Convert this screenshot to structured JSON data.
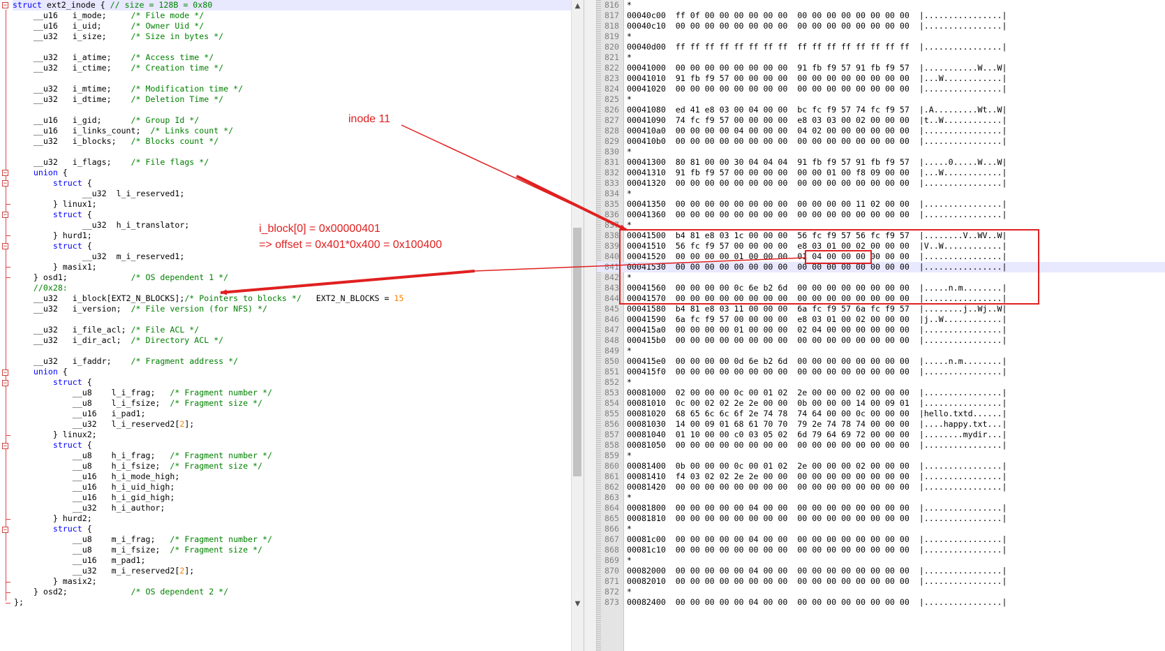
{
  "code_editor": {
    "lines": [
      [
        [
          "kw",
          "struct"
        ],
        [
          "tw",
          " ext2_inode { "
        ],
        [
          "cm",
          "// size = 128B = 0x80"
        ]
      ],
      [
        [
          "tw",
          "    __u16   i_mode;     "
        ],
        [
          "cm",
          "/* File mode */"
        ]
      ],
      [
        [
          "tw",
          "    __u16   i_uid;      "
        ],
        [
          "cm",
          "/* Owner Uid */"
        ]
      ],
      [
        [
          "tw",
          "    __u32   i_size;     "
        ],
        [
          "cm",
          "/* Size in bytes */"
        ]
      ],
      [],
      [
        [
          "tw",
          "    __u32   i_atime;    "
        ],
        [
          "cm",
          "/* Access time */"
        ]
      ],
      [
        [
          "tw",
          "    __u32   i_ctime;    "
        ],
        [
          "cm",
          "/* Creation time */"
        ]
      ],
      [],
      [
        [
          "tw",
          "    __u32   i_mtime;    "
        ],
        [
          "cm",
          "/* Modification time */"
        ]
      ],
      [
        [
          "tw",
          "    __u32   i_dtime;    "
        ],
        [
          "cm",
          "/* Deletion Time */"
        ]
      ],
      [],
      [
        [
          "tw",
          "    __u16   i_gid;      "
        ],
        [
          "cm",
          "/* Group Id */"
        ]
      ],
      [
        [
          "tw",
          "    __u16   i_links_count;  "
        ],
        [
          "cm",
          "/* Links count */"
        ]
      ],
      [
        [
          "tw",
          "    __u32   i_blocks;   "
        ],
        [
          "cm",
          "/* Blocks count */"
        ]
      ],
      [],
      [
        [
          "tw",
          "    __u32   i_flags;    "
        ],
        [
          "cm",
          "/* File flags */"
        ]
      ],
      [
        [
          "kw",
          "    union"
        ],
        [
          "tw",
          " {"
        ]
      ],
      [
        [
          "kw",
          "        struct"
        ],
        [
          "tw",
          " {"
        ]
      ],
      [
        [
          "tw",
          "              __u32  l_i_reserved1;"
        ]
      ],
      [
        [
          "tw",
          "        } linux1;"
        ]
      ],
      [
        [
          "kw",
          "        struct"
        ],
        [
          "tw",
          " {"
        ]
      ],
      [
        [
          "tw",
          "              __u32  h_i_translator;"
        ]
      ],
      [
        [
          "tw",
          "        } hurd1;"
        ]
      ],
      [
        [
          "kw",
          "        struct"
        ],
        [
          "tw",
          " {"
        ]
      ],
      [
        [
          "tw",
          "              __u32  m_i_reserved1;"
        ]
      ],
      [
        [
          "tw",
          "        } masix1;"
        ]
      ],
      [
        [
          "tw",
          "    } osd1;             "
        ],
        [
          "cm",
          "/* OS dependent 1 */"
        ]
      ],
      [
        [
          "cm",
          "    //0x28:"
        ]
      ],
      [
        [
          "tw",
          "    __u32   i_block[EXT2_N_BLOCKS];"
        ],
        [
          "cm",
          "/* Pointers to blocks */"
        ],
        [
          "tw",
          "   EXT2_N_BLOCKS = "
        ],
        [
          "num",
          "15"
        ]
      ],
      [
        [
          "tw",
          "    __u32   i_version;  "
        ],
        [
          "cm",
          "/* File version (for NFS) */"
        ]
      ],
      [],
      [
        [
          "tw",
          "    __u32   i_file_acl; "
        ],
        [
          "cm",
          "/* File ACL */"
        ]
      ],
      [
        [
          "tw",
          "    __u32   i_dir_acl;  "
        ],
        [
          "cm",
          "/* Directory ACL */"
        ]
      ],
      [],
      [
        [
          "tw",
          "    __u32   i_faddr;    "
        ],
        [
          "cm",
          "/* Fragment address */"
        ]
      ],
      [
        [
          "kw",
          "    union"
        ],
        [
          "tw",
          " {"
        ]
      ],
      [
        [
          "kw",
          "        struct"
        ],
        [
          "tw",
          " {"
        ]
      ],
      [
        [
          "tw",
          "            __u8    l_i_frag;   "
        ],
        [
          "cm",
          "/* Fragment number */"
        ]
      ],
      [
        [
          "tw",
          "            __u8    l_i_fsize;  "
        ],
        [
          "cm",
          "/* Fragment size */"
        ]
      ],
      [
        [
          "tw",
          "            __u16   i_pad1;"
        ]
      ],
      [
        [
          "tw",
          "            __u32   l_i_reserved2["
        ],
        [
          "num",
          "2"
        ],
        [
          "tw",
          "];"
        ]
      ],
      [
        [
          "tw",
          "        } linux2;"
        ]
      ],
      [
        [
          "kw",
          "        struct"
        ],
        [
          "tw",
          " {"
        ]
      ],
      [
        [
          "tw",
          "            __u8    h_i_frag;   "
        ],
        [
          "cm",
          "/* Fragment number */"
        ]
      ],
      [
        [
          "tw",
          "            __u8    h_i_fsize;  "
        ],
        [
          "cm",
          "/* Fragment size */"
        ]
      ],
      [
        [
          "tw",
          "            __u16   h_i_mode_high;"
        ]
      ],
      [
        [
          "tw",
          "            __u16   h_i_uid_high;"
        ]
      ],
      [
        [
          "tw",
          "            __u16   h_i_gid_high;"
        ]
      ],
      [
        [
          "tw",
          "            __u32   h_i_author;"
        ]
      ],
      [
        [
          "tw",
          "        } hurd2;"
        ]
      ],
      [
        [
          "kw",
          "        struct"
        ],
        [
          "tw",
          " {"
        ]
      ],
      [
        [
          "tw",
          "            __u8    m_i_frag;   "
        ],
        [
          "cm",
          "/* Fragment number */"
        ]
      ],
      [
        [
          "tw",
          "            __u8    m_i_fsize;  "
        ],
        [
          "cm",
          "/* Fragment size */"
        ]
      ],
      [
        [
          "tw",
          "            __u16   m_pad1;"
        ]
      ],
      [
        [
          "tw",
          "            __u32   m_i_reserved2["
        ],
        [
          "num",
          "2"
        ],
        [
          "tw",
          "];"
        ]
      ],
      [
        [
          "tw",
          "        } masix2;"
        ]
      ],
      [
        [
          "tw",
          "    } osd2;             "
        ],
        [
          "cm",
          "/* OS dependent 2 */"
        ]
      ],
      [
        [
          "tw",
          "};"
        ]
      ]
    ]
  },
  "hex_view": {
    "lines": [
      {
        "n": "816",
        "t": "*"
      },
      {
        "n": "817",
        "t": "00040c00  ff 0f 00 00 00 00 00 00  00 00 00 00 00 00 00 00  |................|"
      },
      {
        "n": "818",
        "t": "00040c10  00 00 00 00 00 00 00 00  00 00 00 00 00 00 00 00  |................|"
      },
      {
        "n": "819",
        "t": "*"
      },
      {
        "n": "820",
        "t": "00040d00  ff ff ff ff ff ff ff ff  ff ff ff ff ff ff ff ff  |................|"
      },
      {
        "n": "821",
        "t": "*"
      },
      {
        "n": "822",
        "t": "00041000  00 00 00 00 00 00 00 00  91 fb f9 57 91 fb f9 57  |...........W...W|"
      },
      {
        "n": "823",
        "t": "00041010  91 fb f9 57 00 00 00 00  00 00 00 00 00 00 00 00  |...W............|"
      },
      {
        "n": "824",
        "t": "00041020  00 00 00 00 00 00 00 00  00 00 00 00 00 00 00 00  |................|"
      },
      {
        "n": "825",
        "t": "*"
      },
      {
        "n": "826",
        "t": "00041080  ed 41 e8 03 00 04 00 00  bc fc f9 57 74 fc f9 57  |.A.........Wt..W|"
      },
      {
        "n": "827",
        "t": "00041090  74 fc f9 57 00 00 00 00  e8 03 03 00 02 00 00 00  |t..W............|"
      },
      {
        "n": "828",
        "t": "000410a0  00 00 00 00 04 00 00 00  04 02 00 00 00 00 00 00  |................|"
      },
      {
        "n": "829",
        "t": "000410b0  00 00 00 00 00 00 00 00  00 00 00 00 00 00 00 00  |................|"
      },
      {
        "n": "830",
        "t": "*"
      },
      {
        "n": "831",
        "t": "00041300  80 81 00 00 30 04 04 04  91 fb f9 57 91 fb f9 57  |.....0.....W...W|"
      },
      {
        "n": "832",
        "t": "00041310  91 fb f9 57 00 00 00 00  00 00 01 00 f8 09 00 00  |...W............|"
      },
      {
        "n": "833",
        "t": "00041320  00 00 00 00 00 00 00 00  00 00 00 00 00 00 00 00  |................|"
      },
      {
        "n": "834",
        "t": "*"
      },
      {
        "n": "835",
        "t": "00041350  00 00 00 00 00 00 00 00  00 00 00 00 11 02 00 00  |................|"
      },
      {
        "n": "836",
        "t": "00041360  00 00 00 00 00 00 00 00  00 00 00 00 00 00 00 00  |................|"
      },
      {
        "n": "837",
        "t": "*"
      },
      {
        "n": "838",
        "t": "00041500  b4 81 e8 03 1c 00 00 00  56 fc f9 57 56 fc f9 57  |........V..WV..W|"
      },
      {
        "n": "839",
        "t": "00041510  56 fc f9 57 00 00 00 00  e8 03 01 00 02 00 00 00  |V..W............|"
      },
      {
        "n": "840",
        "t": "00041520  00 00 00 00 01 00 00 00  01 04 00 00 00 00 00 00  |................|"
      },
      {
        "n": "841",
        "t": "00041530  00 00 00 00 00 00 00 00  00 00 00 00 00 00 00 00  |................|"
      },
      {
        "n": "842",
        "t": "*"
      },
      {
        "n": "843",
        "t": "00041560  00 00 00 00 0c 6e b2 6d  00 00 00 00 00 00 00 00  |.....n.m........|"
      },
      {
        "n": "844",
        "t": "00041570  00 00 00 00 00 00 00 00  00 00 00 00 00 00 00 00  |................|"
      },
      {
        "n": "845",
        "t": "00041580  b4 81 e8 03 11 00 00 00  6a fc f9 57 6a fc f9 57  |........j..Wj..W|"
      },
      {
        "n": "846",
        "t": "00041590  6a fc f9 57 00 00 00 00  e8 03 01 00 02 00 00 00  |j..W............|"
      },
      {
        "n": "847",
        "t": "000415a0  00 00 00 00 01 00 00 00  02 04 00 00 00 00 00 00  |................|"
      },
      {
        "n": "848",
        "t": "000415b0  00 00 00 00 00 00 00 00  00 00 00 00 00 00 00 00  |................|"
      },
      {
        "n": "849",
        "t": "*"
      },
      {
        "n": "850",
        "t": "000415e0  00 00 00 00 0d 6e b2 6d  00 00 00 00 00 00 00 00  |.....n.m........|"
      },
      {
        "n": "851",
        "t": "000415f0  00 00 00 00 00 00 00 00  00 00 00 00 00 00 00 00  |................|"
      },
      {
        "n": "852",
        "t": "*"
      },
      {
        "n": "853",
        "t": "00081000  02 00 00 00 0c 00 01 02  2e 00 00 00 02 00 00 00  |................|"
      },
      {
        "n": "854",
        "t": "00081010  0c 00 02 02 2e 2e 00 00  0b 00 00 00 14 00 09 01  |................|"
      },
      {
        "n": "855",
        "t": "00081020  68 65 6c 6c 6f 2e 74 78  74 64 00 00 0c 00 00 00  |hello.txtd......|"
      },
      {
        "n": "856",
        "t": "00081030  14 00 09 01 68 61 70 70  79 2e 74 78 74 00 00 00  |....happy.txt...|"
      },
      {
        "n": "857",
        "t": "00081040  01 10 00 00 c0 03 05 02  6d 79 64 69 72 00 00 00  |........mydir...|"
      },
      {
        "n": "858",
        "t": "00081050  00 00 00 00 00 00 00 00  00 00 00 00 00 00 00 00  |................|"
      },
      {
        "n": "859",
        "t": "*"
      },
      {
        "n": "860",
        "t": "00081400  0b 00 00 00 0c 00 01 02  2e 00 00 00 02 00 00 00  |................|"
      },
      {
        "n": "861",
        "t": "00081410  f4 03 02 02 2e 2e 00 00  00 00 00 00 00 00 00 00  |................|"
      },
      {
        "n": "862",
        "t": "00081420  00 00 00 00 00 00 00 00  00 00 00 00 00 00 00 00  |................|"
      },
      {
        "n": "863",
        "t": "*"
      },
      {
        "n": "864",
        "t": "00081800  00 00 00 00 00 04 00 00  00 00 00 00 00 00 00 00  |................|"
      },
      {
        "n": "865",
        "t": "00081810  00 00 00 00 00 00 00 00  00 00 00 00 00 00 00 00  |................|"
      },
      {
        "n": "866",
        "t": "*"
      },
      {
        "n": "867",
        "t": "00081c00  00 00 00 00 00 04 00 00  00 00 00 00 00 00 00 00  |................|"
      },
      {
        "n": "868",
        "t": "00081c10  00 00 00 00 00 00 00 00  00 00 00 00 00 00 00 00  |................|"
      },
      {
        "n": "869",
        "t": "*"
      },
      {
        "n": "870",
        "t": "00082000  00 00 00 00 00 04 00 00  00 00 00 00 00 00 00 00  |................|"
      },
      {
        "n": "871",
        "t": "00082010  00 00 00 00 00 00 00 00  00 00 00 00 00 00 00 00  |................|"
      },
      {
        "n": "872",
        "t": "*"
      },
      {
        "n": "873",
        "t": "00082400  00 00 00 00 00 04 00 00  00 00 00 00 00 00 00 00  |................|"
      }
    ]
  },
  "annotations": {
    "inode_label": "inode 11",
    "iblock_line1": "i_block[0] = 0x00000401",
    "iblock_line2": "=> offset = 0x401*0x400 = 0x100400",
    "accent_color": "#e02020"
  },
  "scrollbars": {
    "up_icon": "▲",
    "down_icon": "▼"
  }
}
